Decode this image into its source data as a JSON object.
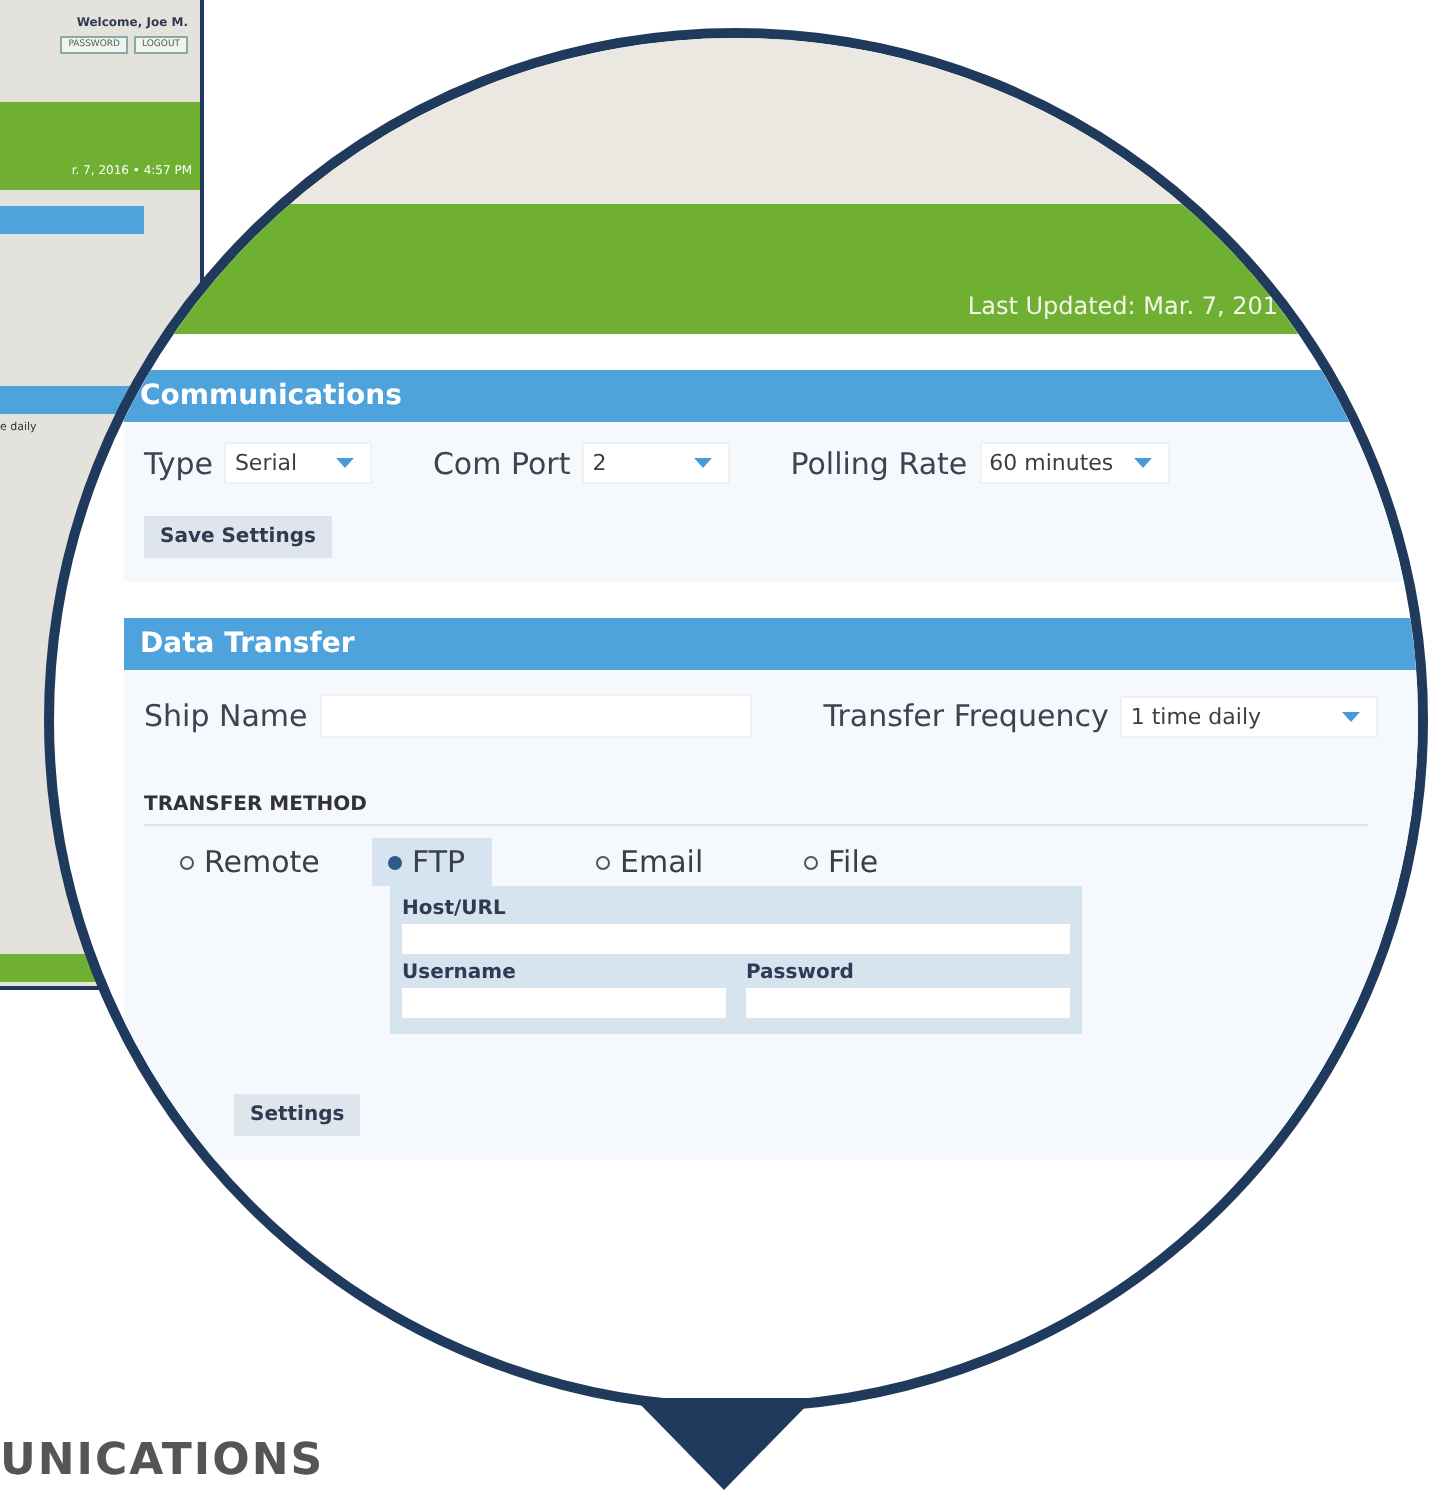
{
  "background_screen": {
    "welcome": "Welcome, Joe M.",
    "buttons": [
      "PASSWORD",
      "LOGOUT"
    ],
    "timestamp": "r. 7, 2016 • 4:57 PM",
    "frequency_value": "e daily"
  },
  "magnified": {
    "last_updated": "Last Updated: Mar. 7, 201",
    "communications": {
      "title": "Communications",
      "fields": [
        {
          "label": "Type",
          "value": "Serial"
        },
        {
          "label": "Com Port",
          "value": "2"
        },
        {
          "label": "Polling Rate",
          "value": "60 minutes"
        }
      ],
      "button": "Save Settings"
    },
    "data_transfer": {
      "title": "Data Transfer",
      "ship_name": {
        "label": "Ship Name"
      },
      "transfer_frequency": {
        "label": "Transfer Frequency",
        "value": "1 time daily"
      },
      "method_heading": "TRANSFER METHOD",
      "methods": [
        {
          "label": "Remote",
          "selected": false
        },
        {
          "label": "FTP",
          "selected": true
        },
        {
          "label": "Email",
          "selected": false
        },
        {
          "label": "File",
          "selected": false
        }
      ],
      "ftp_fields": [
        {
          "label": "Host/URL"
        },
        {
          "label": "Username"
        },
        {
          "label": "Password"
        }
      ],
      "button": "Settings"
    }
  },
  "caption": "UNICATIONS"
}
